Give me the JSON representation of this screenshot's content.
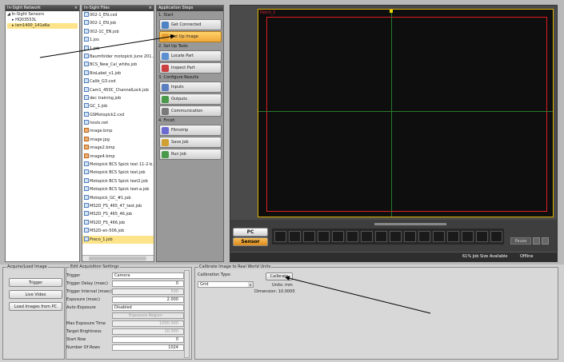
{
  "network": {
    "title": "In-Sight Network",
    "close": "×",
    "items": [
      "In-Sight Sensors",
      "HQ03553L",
      "ism1400_141a6a"
    ]
  },
  "files": {
    "title": "In-Sight Files",
    "close": "×",
    "items": [
      "002-1_EN.cxd",
      "002-1_EN.job",
      "002-1C_EN.job",
      "1.jos",
      "1.job",
      "Baumfolder motopick June 201...",
      "BCS_New_Cal_white.job",
      "BioLabel_v1.job",
      "Calib_G3.cxd",
      "Cam1_450C_ChannelLock.job",
      "dec training.job",
      "GC_1.job",
      "GSMotopick2.cxd",
      "hosts.net",
      "image.bmp",
      "image.jpg",
      "image2.bmp",
      "image4.bmp",
      "Motopick BCS Spick test 11-2-b...",
      "Motopick BCS Spick test.job",
      "Motopick BCS Spick test2.job",
      "Motopick BCS Spick test-a.job",
      "Motopick_GC_#1.job",
      "MS2D_FS_465_47_test.job",
      "MS2D_FS_465_46.job",
      "MS2D_FS_466.job",
      "MS2D-en-506.job",
      "Preco_1.job"
    ]
  },
  "steps": {
    "title": "Application Steps",
    "sections": [
      {
        "label": "1. Start",
        "items": [
          "Get Connected",
          "Set Up Image"
        ]
      },
      {
        "label": "2. Set Up Tools",
        "items": [
          "Locate Part",
          "Inspect Part"
        ]
      },
      {
        "label": "3. Configure Results",
        "items": [
          "Inputs",
          "Outputs",
          "Communication"
        ]
      },
      {
        "label": "4. Finish",
        "items": [
          "Filmstrip",
          "Save Job",
          "Run Job"
        ]
      }
    ]
  },
  "viewer": {
    "pc": "PC",
    "sensor": "Sensor",
    "pause": "Pause",
    "job_size": "61% Job Size Available",
    "status": "Offline"
  },
  "acquire": {
    "title": "Acquire/Load Image",
    "trigger": "Trigger",
    "live": "Live Video",
    "load": "Load Images from PC"
  },
  "settings": {
    "title": "Edit Acquisition Settings",
    "rows": [
      {
        "label": "Trigger",
        "value": "Camera"
      },
      {
        "label": "Trigger Delay (msec)",
        "value": "0"
      },
      {
        "label": "Trigger Interval (msec)",
        "value": "500"
      },
      {
        "label": "Exposure (msec)",
        "value": "2.000"
      },
      {
        "label": "Auto-Exposure",
        "value": "Disabled"
      },
      {
        "label": "",
        "value": "Exposure Region"
      },
      {
        "label": "Max Exposure Time",
        "value": "1000.000"
      },
      {
        "label": "Target Brightness",
        "value": "10.000"
      },
      {
        "label": "Start Row",
        "value": "0"
      },
      {
        "label": "Number Of Rows",
        "value": "1024"
      }
    ]
  },
  "calibrate": {
    "title": "Calibrate Image to Real World Units",
    "type_label": "Calibration Type:",
    "type_value": "Grid",
    "button": "Calibrate",
    "units": "Units: mm",
    "dimension": "Dimension: 10.0000"
  }
}
